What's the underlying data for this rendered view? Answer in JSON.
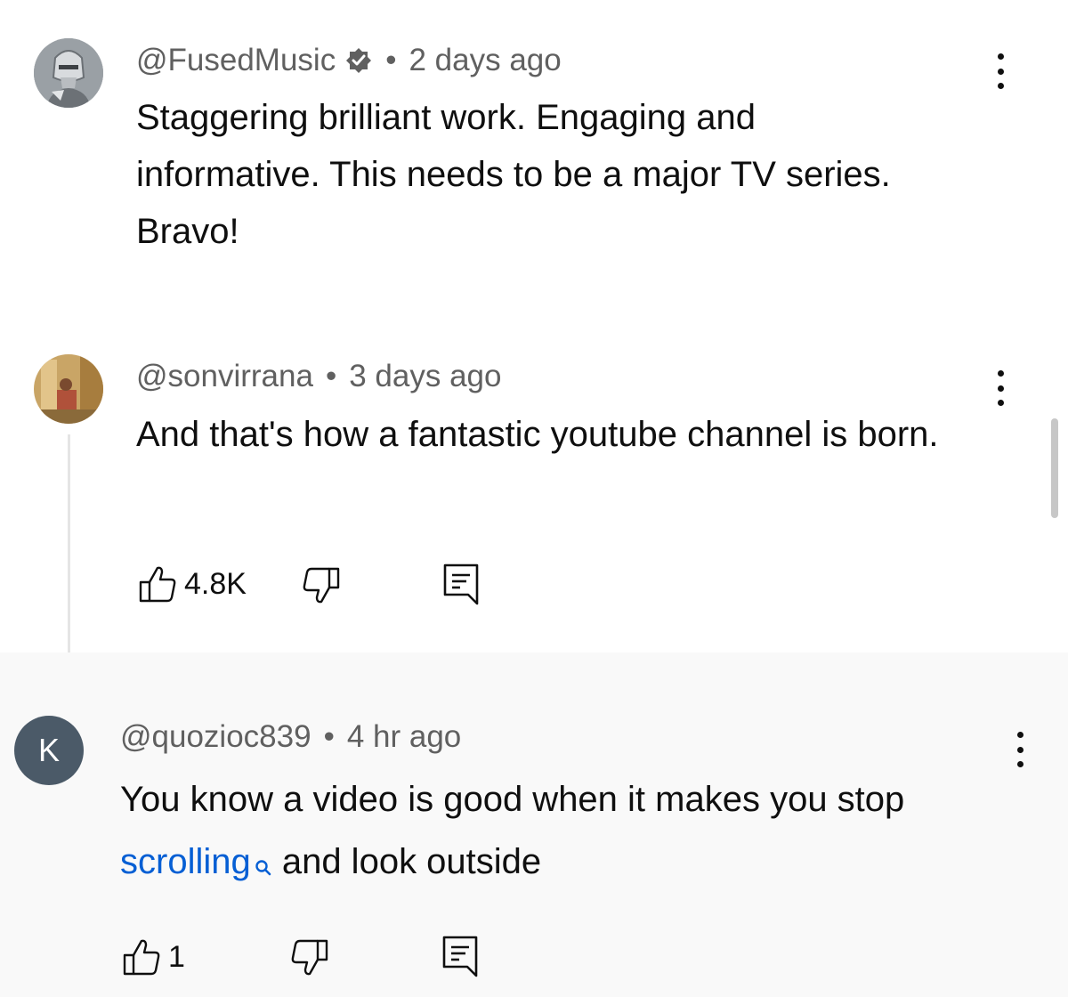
{
  "comments": [
    {
      "handle": "@FusedMusic",
      "verified": true,
      "time": "2 days ago",
      "body_lines": [
        "Staggering brilliant work. Engaging and informative. This needs to be a major TV series.",
        "Bravo!"
      ],
      "avatar_icon": "knight-avatar"
    },
    {
      "handle": "@sonvirrana",
      "time": "3 days ago",
      "body": "And that's how a fantastic youtube channel is born.",
      "likes": "4.8K",
      "avatar_icon": "photo-avatar"
    },
    {
      "handle": "@quozioc839",
      "time": "4 hr ago",
      "avatar_letter": "K",
      "body_before": "You know a video is good when it makes you stop ",
      "body_link": "scrolling",
      "body_after": " and look outside",
      "likes": "1"
    }
  ],
  "separator": "•",
  "colors": {
    "link": "#065fd4",
    "meta": "#606060",
    "avatar_k_bg": "#4b5a68",
    "highlight_bg": "#f9f9f9"
  }
}
